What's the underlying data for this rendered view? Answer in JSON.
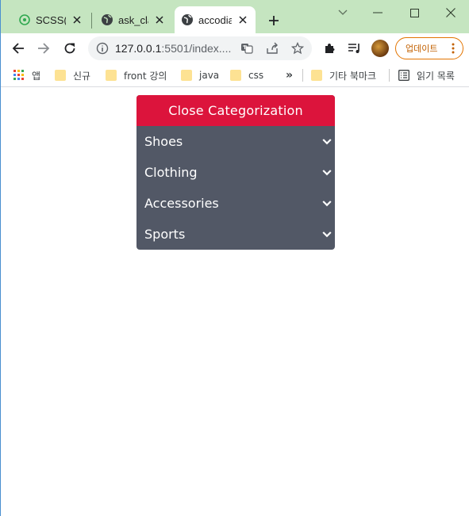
{
  "browser": {
    "tabs": [
      {
        "title": "SCSS(Sa",
        "icon": "scss-favicon-icon",
        "active": false
      },
      {
        "title": "ask_cla",
        "icon": "globe-icon",
        "active": false
      },
      {
        "title": "accodia",
        "icon": "globe-icon",
        "active": true
      }
    ],
    "url_host": "127.0.0.1",
    "url_rest": ":5501/index....",
    "update_label": "업데이트",
    "bookmarks": [
      {
        "label": "앱",
        "icon": "apps-grid-icon"
      },
      {
        "label": "신규",
        "icon": "folder-icon"
      },
      {
        "label": "front 강의",
        "icon": "folder-icon"
      },
      {
        "label": "java",
        "icon": "folder-icon"
      },
      {
        "label": "css",
        "icon": "folder-icon"
      }
    ],
    "overflow_label": "»",
    "other_bookmarks_label": "기타 북마크",
    "reading_list_label": "읽기 목록"
  },
  "accordion": {
    "header_label": "Close Categorization",
    "items": [
      "Shoes",
      "Clothing",
      "Accessories",
      "Sports"
    ]
  },
  "colors": {
    "tab_strip": "#c5e5c0",
    "accordion_header": "#dc143c",
    "accordion_body": "#525866",
    "update_accent": "#e37400"
  }
}
